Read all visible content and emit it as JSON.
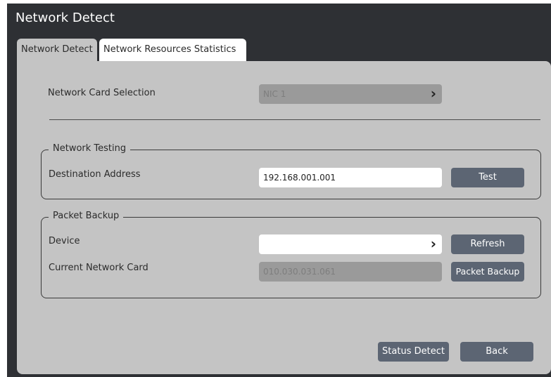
{
  "window": {
    "title": "Network Detect"
  },
  "tabs": [
    {
      "label": "Network Detect"
    },
    {
      "label": "Network Resources Statistics"
    }
  ],
  "network_card": {
    "label": "Network Card Selection",
    "value": "NIC 1"
  },
  "network_testing": {
    "legend": "Network Testing",
    "destination_label": "Destination Address",
    "destination_value": "192.168.001.001",
    "test_button": "Test"
  },
  "packet_backup": {
    "legend": "Packet Backup",
    "device_label": "Device",
    "device_value": "",
    "refresh_button": "Refresh",
    "current_card_label": "Current Network Card",
    "current_card_value": "010.030.031.061",
    "backup_button": "Packet Backup"
  },
  "footer": {
    "status_detect_button": "Status Detect",
    "back_button": "Back"
  }
}
